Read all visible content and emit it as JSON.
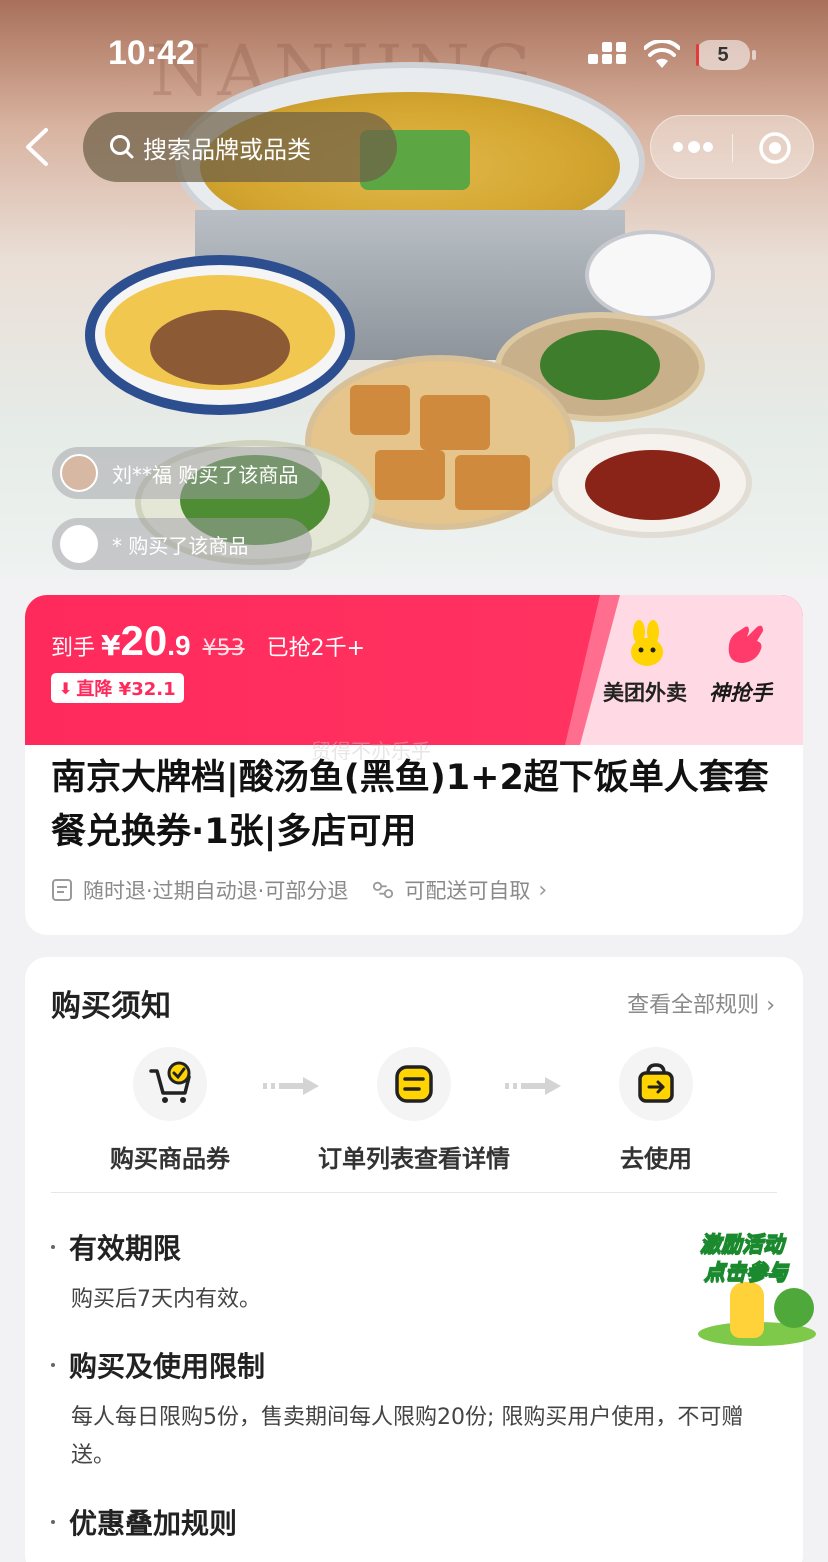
{
  "status_bar": {
    "time": "10:42",
    "battery": "5"
  },
  "hero": {
    "script_text": "NANJING"
  },
  "nav": {
    "search_placeholder": "搜索品牌或品类"
  },
  "buyers": [
    {
      "text": "刘**福 购买了该商品"
    },
    {
      "text": "* 购买了该商品"
    }
  ],
  "price": {
    "label": "到手",
    "currency": "¥",
    "integer": "20",
    "decimal": ".9",
    "original": "¥53",
    "sold": "已抢2千+",
    "drop_badge": "直降 ¥32.1"
  },
  "promo": {
    "brand": "美团外卖",
    "campaign": "神抢手"
  },
  "product": {
    "watermark": "贸得不亦乐乎",
    "title": "南京大牌档|酸汤鱼(黑鱼)1+2超下饭单人套套餐兑换券·1张|多店可用",
    "refund_tags": "随时退·过期自动退·可部分退",
    "delivery_tags": "可配送可自取"
  },
  "notice": {
    "title": "购买须知",
    "all_rules": "查看全部规则",
    "steps": [
      {
        "label": "购买商品券",
        "icon": "cart-check-icon"
      },
      {
        "label": "订单列表查看详情",
        "icon": "list-icon"
      },
      {
        "label": "去使用",
        "icon": "bag-arrow-icon"
      }
    ],
    "rules": [
      {
        "head": "有效期限",
        "body": "购买后7天内有效。"
      },
      {
        "head": "购买及使用限制",
        "body": "每人每日限购5份，售卖期间每人限购20份; 限购买用户使用，不可赠送。"
      },
      {
        "head": "优惠叠加规则",
        "body": ""
      }
    ]
  },
  "activity": {
    "line1": "激励活动",
    "line2": "点击参与"
  },
  "colors": {
    "accent": "#ff2a5c",
    "promo_bg": "#ffd9e3",
    "icon_yellow": "#ffd400"
  }
}
